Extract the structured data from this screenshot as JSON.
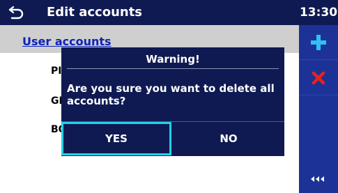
{
  "header": {
    "title": "Edit accounts",
    "time": "13:30"
  },
  "section": {
    "title": "User accounts"
  },
  "accounts": [
    "PI",
    "GI",
    "BO"
  ],
  "dialog": {
    "title": "Warning!",
    "message": "Are you sure you want to delete all accounts?",
    "yes_label": "YES",
    "no_label": "NO"
  },
  "sidebar": {
    "add_icon": "plus-icon",
    "delete_icon": "x-icon",
    "more_icon": "more-icon"
  },
  "colors": {
    "navy": "#0f1a52",
    "sidebar_blue": "#1c3297",
    "accent_cyan": "#1fd3e6",
    "delete_red": "#e8221b",
    "link_blue": "#0d22b8"
  }
}
